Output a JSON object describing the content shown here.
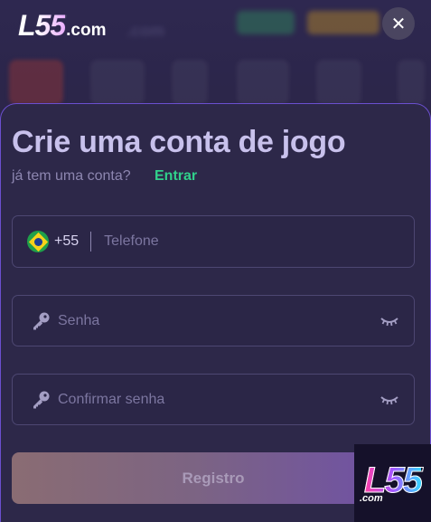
{
  "header": {
    "logo_main": "L55",
    "logo_suffix": ".com",
    "close_label": "✕"
  },
  "background": {
    "faint_text": ".com"
  },
  "form": {
    "title": "Crie uma conta de jogo",
    "subtitle": "já tem uma conta?",
    "login_link": "Entrar",
    "phone": {
      "country_code": "+55",
      "placeholder": "Telefone",
      "value": ""
    },
    "password": {
      "placeholder": "Senha",
      "value": ""
    },
    "confirm_password": {
      "placeholder": "Confirmar senha",
      "value": ""
    },
    "submit_label": "Registro"
  },
  "badge": {
    "main": "L55",
    "suffix": ".com"
  },
  "colors": {
    "accent_green": "#31d08b",
    "panel_border": "#6b4fcf",
    "background": "#2a2546"
  },
  "icons": {
    "close": "close-icon",
    "flag": "brazil-flag-icon",
    "key": "key-icon",
    "eye": "eye-closed-icon"
  }
}
